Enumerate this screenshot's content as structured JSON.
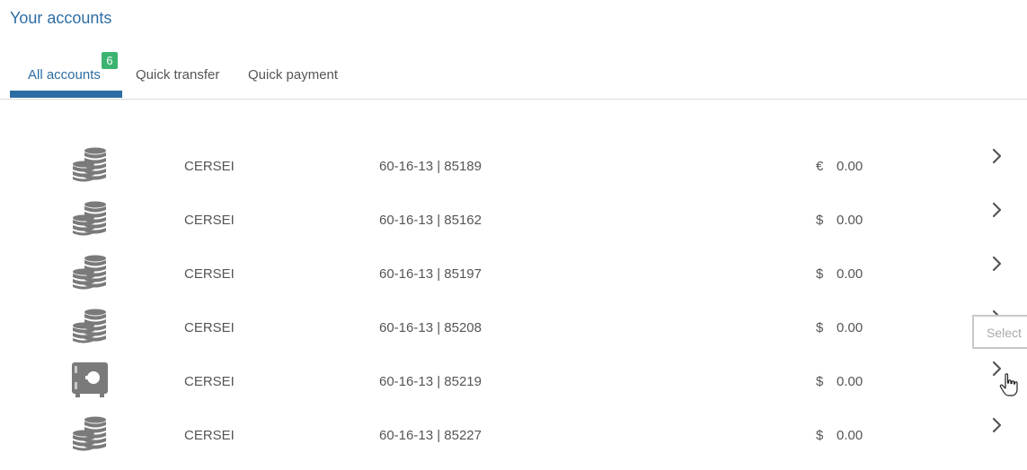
{
  "page": {
    "title": "Your accounts"
  },
  "tabs": [
    {
      "label": "All accounts",
      "active": true,
      "badge": "6"
    },
    {
      "label": "Quick transfer",
      "active": false
    },
    {
      "label": "Quick payment",
      "active": false
    }
  ],
  "accounts": [
    {
      "icon": "coins-stack-icon",
      "name": "CERSEI",
      "number": "60-16-13 | 85189",
      "currency": "€",
      "balance": "0.00"
    },
    {
      "icon": "coins-stack-icon",
      "name": "CERSEI",
      "number": "60-16-13 | 85162",
      "currency": "$",
      "balance": "0.00"
    },
    {
      "icon": "coins-stack-icon",
      "name": "CERSEI",
      "number": "60-16-13 | 85197",
      "currency": "$",
      "balance": "0.00"
    },
    {
      "icon": "coins-stack-icon",
      "name": "CERSEI",
      "number": "60-16-13 | 85208",
      "currency": "$",
      "balance": "0.00"
    },
    {
      "icon": "safe-vault-icon",
      "name": "CERSEI",
      "number": "60-16-13 | 85219",
      "currency": "$",
      "balance": "0.00"
    },
    {
      "icon": "coins-stack-icon",
      "name": "CERSEI",
      "number": "60-16-13 | 85227",
      "currency": "$",
      "balance": "0.00"
    }
  ],
  "tooltip": {
    "label": "Select"
  },
  "colors": {
    "accent": "#2e6da4",
    "badge": "#3cb371",
    "icon": "#7a7a7a"
  }
}
